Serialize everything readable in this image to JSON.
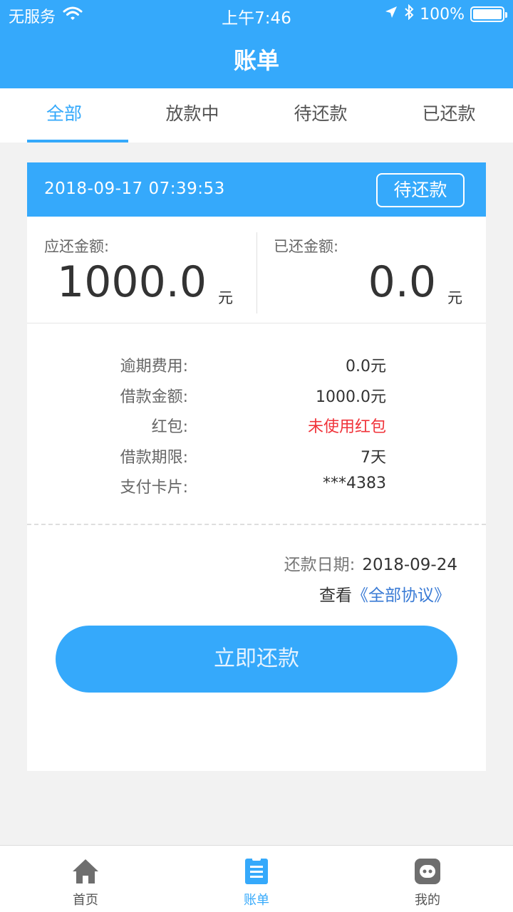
{
  "status_bar": {
    "carrier": "无服务",
    "time": "上午7:46",
    "battery_text": "100%",
    "battery_level": 1.0
  },
  "nav": {
    "title": "账单"
  },
  "tabs": [
    {
      "label": "全部",
      "active": true
    },
    {
      "label": "放款中",
      "active": false
    },
    {
      "label": "待还款",
      "active": false
    },
    {
      "label": "已还款",
      "active": false
    }
  ],
  "card": {
    "date": "2018-09-17 07:39:53",
    "status": "待还款",
    "due_amount": {
      "label": "应还金额:",
      "value": "1000.0",
      "unit": "元"
    },
    "paid_amount": {
      "label": "已还金额:",
      "value": "0.0",
      "unit": "元"
    },
    "details": [
      {
        "label": "逾期费用:",
        "value": "0.0元"
      },
      {
        "label": "借款金额:",
        "value": "1000.0元"
      },
      {
        "label": "红包:",
        "value": "未使用红包"
      },
      {
        "label": "借款期限:",
        "value": "7天"
      },
      {
        "label": "支付卡片:",
        "value": "***4383"
      }
    ],
    "repay_date": {
      "label": "还款日期:",
      "value": "2018-09-24"
    },
    "agreement": {
      "prefix": "查看",
      "link": "《全部协议》"
    },
    "pay_button": "立即还款"
  },
  "bottom_nav": [
    {
      "label": "首页",
      "icon": "home-icon",
      "active": false
    },
    {
      "label": "账单",
      "icon": "bill-icon",
      "active": true
    },
    {
      "label": "我的",
      "icon": "profile-icon",
      "active": false
    }
  ],
  "colors": {
    "primary": "#35a9fb",
    "red": "#f0333a",
    "link": "#3a7bd5"
  }
}
